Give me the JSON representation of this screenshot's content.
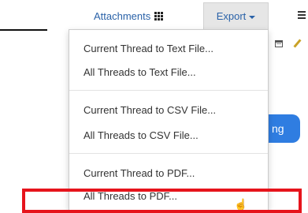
{
  "toolbar": {
    "attachments_label": "Attachments",
    "export_label": "Export"
  },
  "chat": {
    "bubble_text": "ng"
  },
  "export_menu": {
    "items": [
      "Current Thread to Text File...",
      "All Threads to Text File...",
      "Current Thread to CSV File...",
      "All Threads to CSV File...",
      "Current Thread to PDF...",
      "All Threads to PDF..."
    ]
  },
  "icons": {
    "attachments": "grid-icon",
    "export": "caret-down-icon",
    "menu": "hamburger-icon",
    "calendar": "calendar-icon",
    "edit": "pencil-icon",
    "cursor": "hand-cursor-icon"
  },
  "colors": {
    "link_blue": "#2a62a8",
    "export_bg": "#e6e6e6",
    "bubble_blue": "#2f7de1",
    "highlight_red": "#e6141c"
  }
}
